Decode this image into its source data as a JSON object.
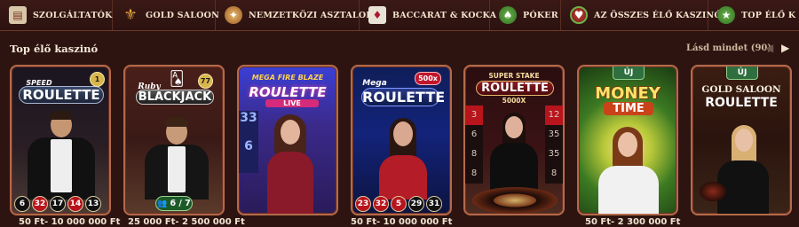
{
  "nav": {
    "items": [
      {
        "label": "SZOLGÁLTATÓK",
        "icon": "book-icon"
      },
      {
        "label": "GOLD SALOON",
        "icon": "fleur-de-lis-icon"
      },
      {
        "label": "NEMZETKÖZI ASZTALOK",
        "icon": "coin-icon"
      },
      {
        "label": "BACCARAT & KOCKA",
        "icon": "cards-icon"
      },
      {
        "label": "PÓKER",
        "icon": "poker-chip-icon"
      },
      {
        "label": "AZ ÖSSZES ÉLŐ KASZINÓ",
        "icon": "live-chip-icon"
      },
      {
        "label": "TOP ÉLŐ K",
        "icon": "top-chip-icon"
      }
    ]
  },
  "section": {
    "title": "Top élő kaszinó",
    "see_all": "Lásd mindet (90)"
  },
  "cards": [
    {
      "logo_top": "SPEED",
      "logo_main": "ROULETTE",
      "logo_badge": "1",
      "results": [
        "6",
        "32",
        "17",
        "14",
        "13"
      ],
      "price": "50 Ft- 10 000 000 Ft"
    },
    {
      "logo_top": "Ruby",
      "logo_main": "BLACKJACK",
      "logo_badge": "77",
      "seats": "6 / 7",
      "price": "25 000 Ft- 2 500 000 Ft"
    },
    {
      "logo_top": "MEGA FIRE BLAZE",
      "logo_main": "ROULETTE",
      "logo_sub": "LIVE",
      "price": ""
    },
    {
      "logo_top": "Mega",
      "logo_main": "ROULETTE",
      "logo_badge": "500x",
      "results": [
        "23",
        "32",
        "5",
        "29",
        "31"
      ],
      "price": "50 Ft- 10 000 000 Ft"
    },
    {
      "logo_top": "SUPER STAKE",
      "logo_main": "ROULETTE",
      "logo_sub": "5000X",
      "price": ""
    },
    {
      "badge": "ÚJ",
      "logo_top": "MONEY",
      "logo_main": "TIME",
      "price": "50 Ft- 2 300 000 Ft"
    },
    {
      "badge": "ÚJ",
      "logo_top": "GOLD SALOON",
      "logo_main": "ROULETTE",
      "price": ""
    }
  ],
  "colors": {
    "background": "#2e1411",
    "card_border": "#b46a4a",
    "red_number": "#b8141c",
    "black_number": "#111111",
    "new_badge": "#2e6e3f"
  }
}
